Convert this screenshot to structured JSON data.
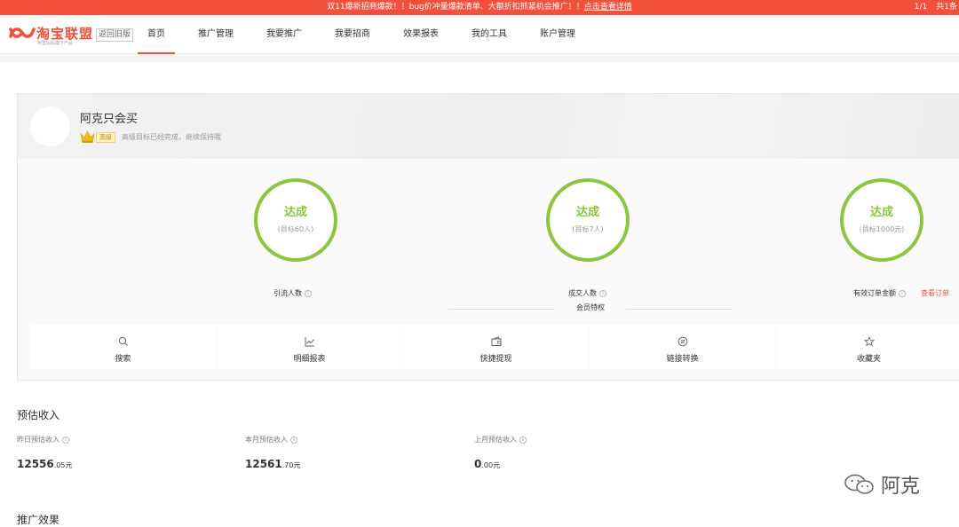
{
  "notice": {
    "message_prefix": "双11爆新招商爆款！！bug价冲量爆款清单、大额折扣抓紧机会推广！！",
    "link": "点击查看详情",
    "page": "1/1",
    "total": "共1条"
  },
  "header": {
    "logo_name": "淘宝联盟",
    "logo_slogan": "阿里妈妈旗下产品",
    "old_version": "返回旧版",
    "nav": [
      "首页",
      "推广管理",
      "我要推广",
      "我要招商",
      "效果报表",
      "我的工具",
      "账户管理"
    ],
    "active_index": 0
  },
  "profile": {
    "username": "阿克只会买",
    "level": "高级",
    "level_message": "高级目标已经完成，继续保持哦",
    "metrics": [
      {
        "status": "达成",
        "target": "(目标60人)",
        "label": "引流人数"
      },
      {
        "status": "达成",
        "target": "(目标7人)",
        "label": "成交人数"
      },
      {
        "status": "达成",
        "target": "(目标1000元)",
        "label": "有效订单金额"
      }
    ],
    "view_order": "查看订单"
  },
  "perks": {
    "title": "会员特权",
    "items": [
      {
        "label": "搜索",
        "icon": "search-icon"
      },
      {
        "label": "明细报表",
        "icon": "chart-icon"
      },
      {
        "label": "快捷提现",
        "icon": "wallet-icon"
      },
      {
        "label": "链接转换",
        "icon": "convert-icon"
      },
      {
        "label": "收藏夹",
        "icon": "star-icon"
      }
    ]
  },
  "income": {
    "title": "预估收入",
    "items": [
      {
        "label": "昨日预估收入",
        "int": "12556",
        "dec": ".05元"
      },
      {
        "label": "本月预估收入",
        "int": "12561",
        "dec": ".70元"
      },
      {
        "label": "上月预估收入",
        "int": "0",
        "dec": ".00元"
      }
    ]
  },
  "effect": {
    "title": "推广效果"
  },
  "watermark": {
    "text": "阿克"
  },
  "colors": {
    "brand": "#f2503a",
    "success": "#8cc63f"
  }
}
